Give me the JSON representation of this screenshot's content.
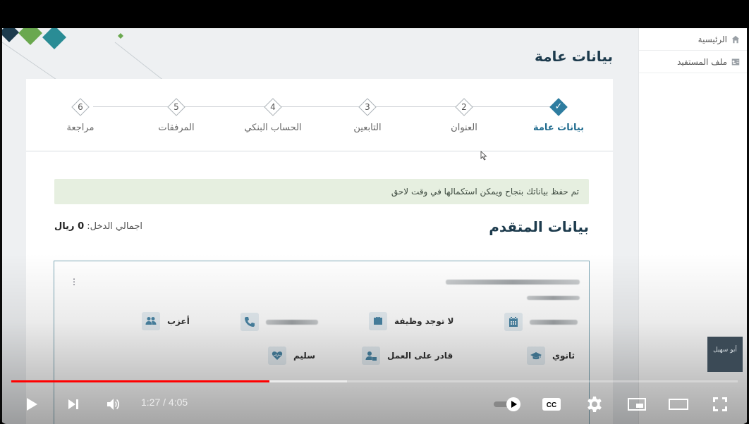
{
  "sidebar": {
    "items": [
      {
        "label": "الرئيسية",
        "icon": "home-icon"
      },
      {
        "label": "ملف المستفيد",
        "icon": "id-card-icon"
      }
    ]
  },
  "page": {
    "title": "بيانات عامة"
  },
  "stepper": {
    "steps": [
      {
        "num": "",
        "label": "بيانات عامة",
        "state": "completed"
      },
      {
        "num": "2",
        "label": "العنوان"
      },
      {
        "num": "3",
        "label": "التابعين"
      },
      {
        "num": "4",
        "label": "الحساب البنكي"
      },
      {
        "num": "5",
        "label": "المرفقات"
      },
      {
        "num": "6",
        "label": "مراجعة"
      }
    ]
  },
  "alert": {
    "text": "تم حفظ بياناتك بنجاح ويمكن استكمالها في وقت لاحق"
  },
  "applicant": {
    "section_title": "بيانات المتقدم",
    "income_label": "اجمالي الدخل:",
    "income_value": "0 ريال",
    "fields": {
      "employment": "لا توجد وظيفة",
      "marital_status": "أعزب",
      "education": "ثانوي",
      "work_ability": "قادر على العمل",
      "health": "سليم"
    }
  },
  "player": {
    "time": "1:27 / 4:05",
    "progress": 0.355,
    "buffered": 0.462,
    "logo_text": "أبو سهيل"
  },
  "colors": {
    "accent": "#2e7da0",
    "title": "#1d3b4d",
    "alert_bg": "#e6efe0",
    "progress": "#ff0000"
  }
}
